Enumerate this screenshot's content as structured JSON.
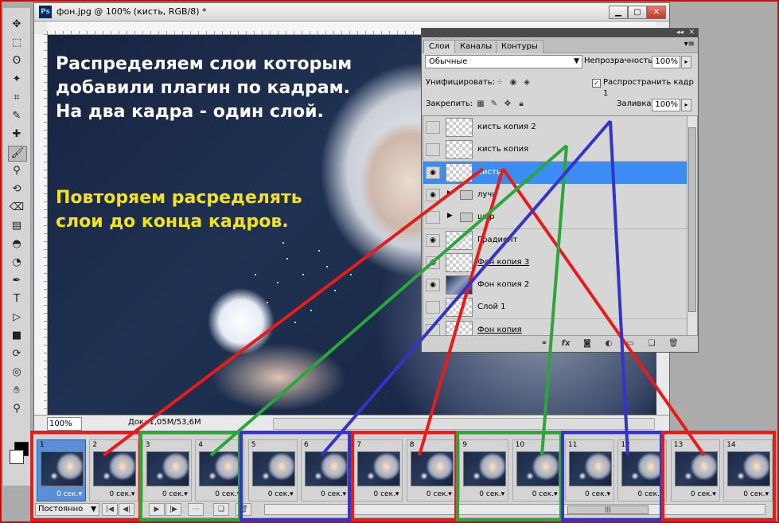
{
  "document": {
    "title": "фон.jpg @ 100% (кисть, RGB/8) *",
    "app_icon": "Ps",
    "zoom": "100%",
    "doc_info": "Док: 1,05M/53,6M"
  },
  "window_buttons": {
    "minimize": "▁",
    "maximize": "▢",
    "close": "✕"
  },
  "annotation": {
    "text_white": "Распределяем слои которым добавили плагин по кадрам. На два кадра - один слой.",
    "text_yellow": "Повторяем расределять слои до конца кадров."
  },
  "layers_panel": {
    "tabs": [
      "Слои",
      "Каналы",
      "Контуры"
    ],
    "blend_mode": "Обычные",
    "opacity_label": "Непрозрачность:",
    "opacity_value": "100%",
    "unify_label": "Унифицировать:",
    "propagate_label": "Распространить кадр 1",
    "propagate_checked": "✓",
    "lock_label": "Закрепить:",
    "fill_label": "Заливка:",
    "fill_value": "100%",
    "layers": [
      {
        "name": "кисть копия 2",
        "visible": false,
        "selected": false,
        "kind": "transparent"
      },
      {
        "name": "кисть копия",
        "visible": false,
        "selected": false,
        "kind": "transparent"
      },
      {
        "name": "кисть",
        "visible": true,
        "selected": true,
        "kind": "transparent"
      },
      {
        "name": "лучи",
        "visible": true,
        "selected": false,
        "kind": "group"
      },
      {
        "name": "шар",
        "visible": false,
        "selected": false,
        "kind": "group"
      },
      {
        "name": "Градиент",
        "visible": true,
        "selected": false,
        "kind": "transparent"
      },
      {
        "name": "Фон копия 3",
        "visible": true,
        "selected": false,
        "kind": "transparent"
      },
      {
        "name": "Фон копия 2",
        "visible": true,
        "selected": false,
        "kind": "photo"
      },
      {
        "name": "Слой 1",
        "visible": false,
        "selected": false,
        "kind": "transparent"
      },
      {
        "name": "Фон копия",
        "visible": false,
        "selected": false,
        "kind": "transparent"
      }
    ]
  },
  "animation": {
    "loop": "Постоянно",
    "frames": [
      {
        "num": "1",
        "delay": "0 сек."
      },
      {
        "num": "2",
        "delay": "0 сек."
      },
      {
        "num": "3",
        "delay": "0 сек."
      },
      {
        "num": "4",
        "delay": "0 сек."
      },
      {
        "num": "5",
        "delay": "0 сек."
      },
      {
        "num": "6",
        "delay": "0 сек."
      },
      {
        "num": "7",
        "delay": "0 сек."
      },
      {
        "num": "8",
        "delay": "0 сек."
      },
      {
        "num": "9",
        "delay": "0 сек."
      },
      {
        "num": "10",
        "delay": "0 сек."
      },
      {
        "num": "11",
        "delay": "0 сек."
      },
      {
        "num": "12",
        "delay": "0 сек."
      },
      {
        "num": "13",
        "delay": "0 сек."
      },
      {
        "num": "14",
        "delay": "0 сек."
      }
    ],
    "selected_frame": "1"
  },
  "tools": [
    "move-tool-icon",
    "marquee-tool-icon",
    "lasso-tool-icon",
    "magic-wand-icon",
    "crop-tool-icon",
    "eyedropper-icon",
    "healing-brush-icon",
    "brush-tool-icon",
    "clone-stamp-icon",
    "history-brush-icon",
    "eraser-icon",
    "gradient-tool-icon",
    "blur-tool-icon",
    "dodge-tool-icon",
    "pen-tool-icon",
    "type-tool-icon",
    "path-selection-icon",
    "rectangle-tool-icon",
    "3d-rotate-icon",
    "3d-orbit-icon",
    "hand-tool-icon",
    "zoom-tool-icon"
  ],
  "colors": {
    "arrow_red": "#e81b1b",
    "arrow_green": "#2aa63a",
    "arrow_blue": "#3434cc",
    "highlight_yellow": "#f5e31a",
    "selection_blue": "#3b8cf3"
  }
}
